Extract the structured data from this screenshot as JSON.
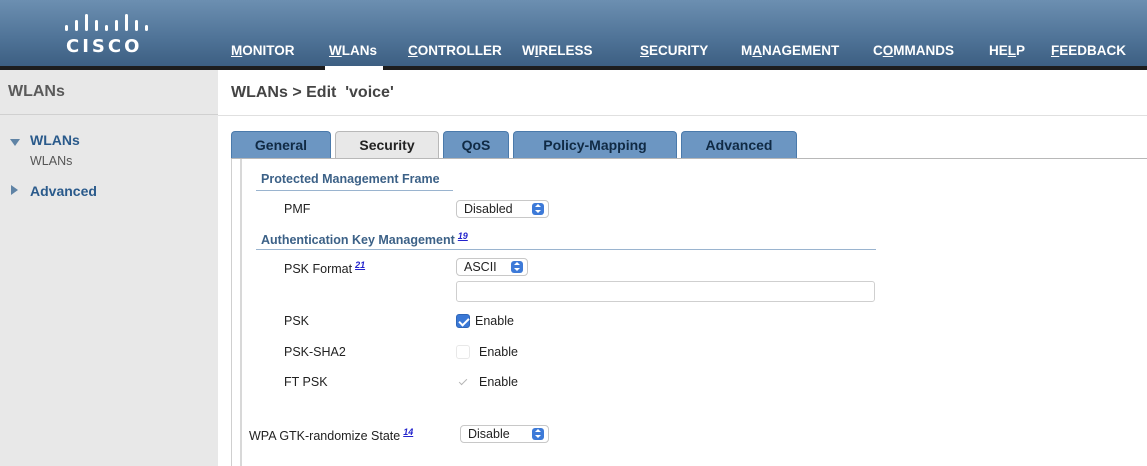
{
  "brand": {
    "logo_text": "CISCO"
  },
  "nav": [
    {
      "pre": "",
      "u": "M",
      "post": "ONITOR"
    },
    {
      "pre": "",
      "u": "W",
      "post": "LANs"
    },
    {
      "pre": "",
      "u": "C",
      "post": "ONTROLLER"
    },
    {
      "pre": "W",
      "u": "I",
      "post": "RELESS"
    },
    {
      "pre": "",
      "u": "S",
      "post": "ECURITY"
    },
    {
      "pre": "M",
      "u": "A",
      "post": "NAGEMENT"
    },
    {
      "pre": "C",
      "u": "O",
      "post": "MMANDS"
    },
    {
      "pre": "HE",
      "u": "L",
      "post": "P"
    },
    {
      "pre": "",
      "u": "F",
      "post": "EEDBACK"
    }
  ],
  "leftnav": {
    "title": "WLANs",
    "wlans_link": "WLANs",
    "wlans_sub": "WLANs",
    "advanced_link": "Advanced"
  },
  "page": {
    "title": "WLANs > Edit  'voice'"
  },
  "tabs": [
    "General",
    "Security",
    "QoS",
    "Policy-Mapping",
    "Advanced"
  ],
  "pmf_section": {
    "title": "Protected Management Frame",
    "pmf_label": "PMF",
    "pmf_value": "Disabled"
  },
  "akm_section": {
    "title": "Authentication Key Management",
    "title_footnote": "19",
    "psk_format_label": "PSK Format",
    "psk_format_footnote": "21",
    "psk_format_value": "ASCII",
    "psk_key_value": "",
    "rows": [
      {
        "label": "PSK",
        "state": "checked",
        "option": "Enable"
      },
      {
        "label": "PSK-SHA2",
        "state": "empty",
        "option": "Enable"
      },
      {
        "label": "FT PSK",
        "state": "disabled",
        "option": "Enable"
      }
    ]
  },
  "gtk": {
    "label": "WPA GTK-randomize State",
    "footnote": "14",
    "value": "Disable"
  },
  "colors": {
    "header": "#4f7397",
    "tab": "#6c96c2",
    "section_title": "#3c6187",
    "link": "#2a5a8b",
    "checkbox": "#3a78d6"
  }
}
